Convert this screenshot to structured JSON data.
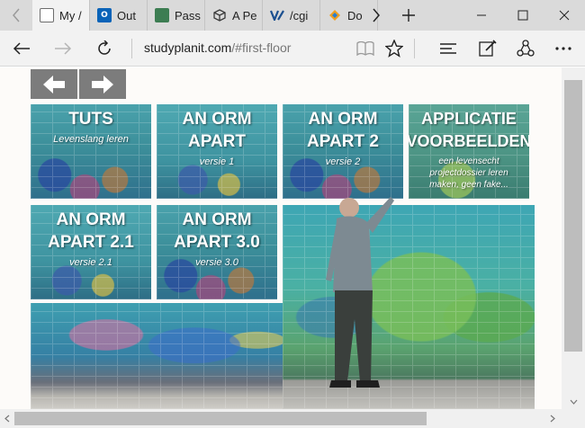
{
  "browser": {
    "tabs": [
      {
        "title": "My /",
        "icon": "doc-icon",
        "color": "#6d6d6d"
      },
      {
        "title": "Out",
        "icon": "outlook-icon",
        "color": "#0a63b8"
      },
      {
        "title": "Pass",
        "icon": "lock-icon",
        "color": "#3c7d52"
      },
      {
        "title": "A Pe",
        "icon": "cube-icon",
        "color": "#3a3a3a"
      },
      {
        "title": "/cgi",
        "icon": "vs-icon",
        "color": "#1a4f8f"
      },
      {
        "title": "Do",
        "icon": "diamond-icon",
        "color": "#f0a020"
      }
    ],
    "address": {
      "host": "studyplanit.com",
      "path": "/#first-floor"
    }
  },
  "page": {
    "tiles": [
      {
        "title_lines": [
          "TUTS"
        ],
        "subtitle": "Levenslang leren"
      },
      {
        "title_lines": [
          "AN ORM",
          "APART"
        ],
        "subtitle": "versie 1"
      },
      {
        "title_lines": [
          "AN ORM",
          "APART 2"
        ],
        "subtitle": "versie 2"
      },
      {
        "title_lines": [
          "APPLICATIE",
          "VOORBEELDEN"
        ],
        "subtitle": "een levensecht projectdossier leren maken, geen fake..."
      },
      {
        "title_lines": [
          "AN ORM",
          "APART 2.1"
        ],
        "subtitle": "versie 2.1"
      },
      {
        "title_lines": [
          "AN ORM",
          "APART 3.0"
        ],
        "subtitle": "versie 3.0"
      }
    ]
  },
  "colors": {
    "nav_arrow_bg": "#7c7c7c",
    "tab_strip": "#dadada",
    "toolbar": "#f2f2f2"
  }
}
